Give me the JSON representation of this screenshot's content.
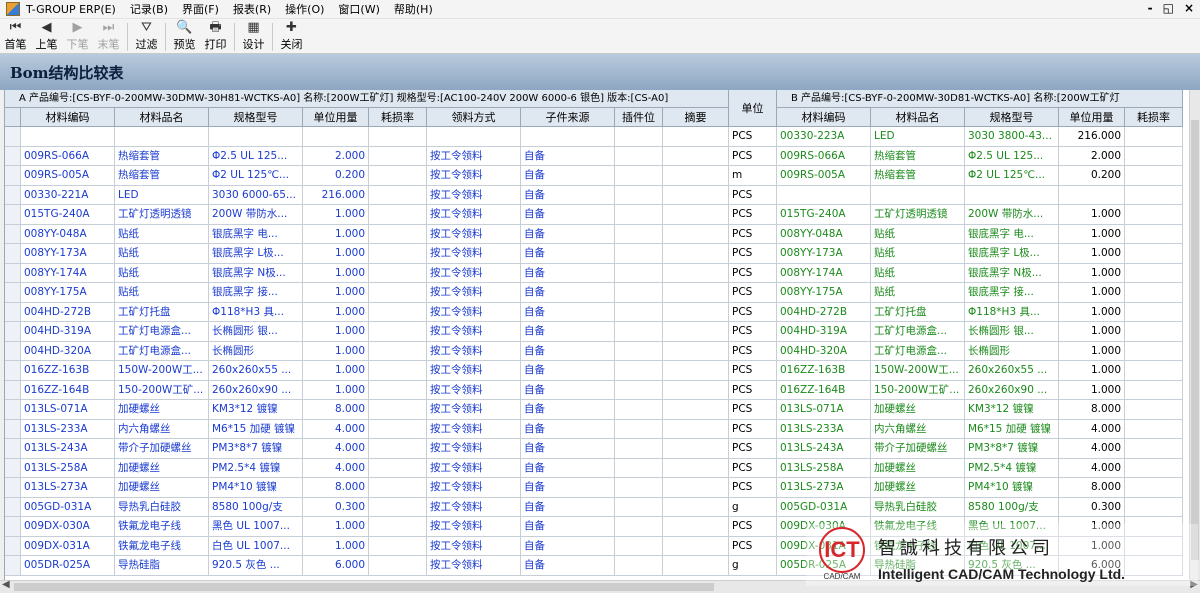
{
  "app": {
    "title": "T-GROUP ERP(E)",
    "menu": [
      "记录(B)",
      "界面(F)",
      "报表(R)",
      "操作(O)",
      "窗口(W)",
      "帮助(H)"
    ],
    "window_controls": [
      "-",
      "◱",
      "×"
    ]
  },
  "toolbar": [
    {
      "label": "首笔",
      "icon": "first-record-icon",
      "glyph": "⏮",
      "enabled": true
    },
    {
      "label": "上笔",
      "icon": "prev-record-icon",
      "glyph": "◀",
      "enabled": true
    },
    {
      "label": "下笔",
      "icon": "next-record-icon",
      "glyph": "▶",
      "enabled": false
    },
    {
      "label": "末笔",
      "icon": "last-record-icon",
      "glyph": "⏭",
      "enabled": false
    },
    {
      "label": "过滤",
      "icon": "filter-icon",
      "glyph": "⛛",
      "enabled": true
    },
    {
      "label": "预览",
      "icon": "preview-icon",
      "glyph": "🔍",
      "enabled": true
    },
    {
      "label": "打印",
      "icon": "print-icon",
      "glyph": "🖶",
      "enabled": true
    },
    {
      "label": "设计",
      "icon": "design-icon",
      "glyph": "▦",
      "enabled": true
    },
    {
      "label": "关闭",
      "icon": "close-icon",
      "glyph": "✚",
      "enabled": true
    }
  ],
  "page_title": "Bom结构比较表",
  "grid": {
    "a_header": "A 产品编号:[CS-BYF-0-200MW-30DMW-30H81-WCTKS-A0] 名称:[200W工矿灯] 规格型号:[AC100-240V 200W 6000-6 银色] 版本:[CS-A0]",
    "b_header": "B 产品编号:[CS-BYF-0-200MW-30D81-WCTKS-A0] 名称:[200W工矿灯",
    "unit_header": "单位",
    "a_columns": [
      "材料编码",
      "材料品名",
      "规格型号",
      "单位用量",
      "耗损率",
      "领料方式",
      "子件来源",
      "插件位",
      "摘要"
    ],
    "b_columns": [
      "材料编码",
      "材料品名",
      "规格型号",
      "单位用量",
      "耗损率"
    ],
    "rows": [
      {
        "a": [
          "",
          "",
          "",
          "",
          "",
          "",
          "",
          "",
          ""
        ],
        "unit": "PCS",
        "b": [
          "00330-223A",
          "LED",
          "3030 3800-43...",
          "216.000",
          ""
        ]
      },
      {
        "a": [
          "009RS-066A",
          "热缩套管",
          "Φ2.5 UL 125...",
          "2.000",
          "",
          "按工令领料",
          "自备",
          "",
          ""
        ],
        "unit": "PCS",
        "b": [
          "009RS-066A",
          "热缩套管",
          "Φ2.5 UL 125...",
          "2.000",
          ""
        ]
      },
      {
        "a": [
          "009RS-005A",
          "热缩套管",
          "Φ2 UL 125℃...",
          "0.200",
          "",
          "按工令领料",
          "自备",
          "",
          ""
        ],
        "unit": "m",
        "b": [
          "009RS-005A",
          "热缩套管",
          "Φ2 UL 125℃...",
          "0.200",
          ""
        ]
      },
      {
        "a": [
          "00330-221A",
          "LED",
          "3030 6000-65...",
          "216.000",
          "",
          "按工令领料",
          "自备",
          "",
          ""
        ],
        "unit": "PCS",
        "b": [
          "",
          "",
          "",
          "",
          ""
        ]
      },
      {
        "a": [
          "015TG-240A",
          "工矿灯透明透镜",
          "200W 带防水...",
          "1.000",
          "",
          "按工令领料",
          "自备",
          "",
          ""
        ],
        "unit": "PCS",
        "b": [
          "015TG-240A",
          "工矿灯透明透镜",
          "200W 带防水...",
          "1.000",
          ""
        ]
      },
      {
        "a": [
          "008YY-048A",
          "贴纸",
          "银底黑字 电...",
          "1.000",
          "",
          "按工令领料",
          "自备",
          "",
          ""
        ],
        "unit": "PCS",
        "b": [
          "008YY-048A",
          "贴纸",
          "银底黑字 电...",
          "1.000",
          ""
        ]
      },
      {
        "a": [
          "008YY-173A",
          "贴纸",
          "银底黑字 L极...",
          "1.000",
          "",
          "按工令领料",
          "自备",
          "",
          ""
        ],
        "unit": "PCS",
        "b": [
          "008YY-173A",
          "贴纸",
          "银底黑字 L极...",
          "1.000",
          ""
        ]
      },
      {
        "a": [
          "008YY-174A",
          "贴纸",
          "银底黑字 N极...",
          "1.000",
          "",
          "按工令领料",
          "自备",
          "",
          ""
        ],
        "unit": "PCS",
        "b": [
          "008YY-174A",
          "贴纸",
          "银底黑字 N极...",
          "1.000",
          ""
        ]
      },
      {
        "a": [
          "008YY-175A",
          "贴纸",
          "银底黑字 接...",
          "1.000",
          "",
          "按工令领料",
          "自备",
          "",
          ""
        ],
        "unit": "PCS",
        "b": [
          "008YY-175A",
          "贴纸",
          "银底黑字 接...",
          "1.000",
          ""
        ]
      },
      {
        "a": [
          "004HD-272B",
          "工矿灯托盘",
          "Φ118*H3 具...",
          "1.000",
          "",
          "按工令领料",
          "自备",
          "",
          ""
        ],
        "unit": "PCS",
        "b": [
          "004HD-272B",
          "工矿灯托盘",
          "Φ118*H3 具...",
          "1.000",
          ""
        ]
      },
      {
        "a": [
          "004HD-319A",
          "工矿灯电源盒...",
          "长椭圆形 银...",
          "1.000",
          "",
          "按工令领料",
          "自备",
          "",
          ""
        ],
        "unit": "PCS",
        "b": [
          "004HD-319A",
          "工矿灯电源盒...",
          "长椭圆形 银...",
          "1.000",
          ""
        ]
      },
      {
        "a": [
          "004HD-320A",
          "工矿灯电源盒...",
          "长椭圆形",
          "1.000",
          "",
          "按工令领料",
          "自备",
          "",
          ""
        ],
        "unit": "PCS",
        "b": [
          "004HD-320A",
          "工矿灯电源盒...",
          "长椭圆形",
          "1.000",
          ""
        ]
      },
      {
        "a": [
          "016ZZ-163B",
          "150W-200W工...",
          "260x260x55 ...",
          "1.000",
          "",
          "按工令领料",
          "自备",
          "",
          ""
        ],
        "unit": "PCS",
        "b": [
          "016ZZ-163B",
          "150W-200W工...",
          "260x260x55 ...",
          "1.000",
          ""
        ]
      },
      {
        "a": [
          "016ZZ-164B",
          "150-200W工矿...",
          "260x260x90 ...",
          "1.000",
          "",
          "按工令领料",
          "自备",
          "",
          ""
        ],
        "unit": "PCS",
        "b": [
          "016ZZ-164B",
          "150-200W工矿...",
          "260x260x90 ...",
          "1.000",
          ""
        ]
      },
      {
        "a": [
          "013LS-071A",
          "加硬螺丝",
          "KM3*12 镀镍",
          "8.000",
          "",
          "按工令领料",
          "自备",
          "",
          ""
        ],
        "unit": "PCS",
        "b": [
          "013LS-071A",
          "加硬螺丝",
          "KM3*12 镀镍",
          "8.000",
          ""
        ]
      },
      {
        "a": [
          "013LS-233A",
          "内六角螺丝",
          "M6*15 加硬 镀镍",
          "4.000",
          "",
          "按工令领料",
          "自备",
          "",
          ""
        ],
        "unit": "PCS",
        "b": [
          "013LS-233A",
          "内六角螺丝",
          "M6*15 加硬 镀镍",
          "4.000",
          ""
        ]
      },
      {
        "a": [
          "013LS-243A",
          "带介子加硬螺丝",
          "PM3*8*7 镀镍",
          "4.000",
          "",
          "按工令领料",
          "自备",
          "",
          ""
        ],
        "unit": "PCS",
        "b": [
          "013LS-243A",
          "带介子加硬螺丝",
          "PM3*8*7 镀镍",
          "4.000",
          ""
        ]
      },
      {
        "a": [
          "013LS-258A",
          "加硬螺丝",
          "PM2.5*4 镀镍",
          "4.000",
          "",
          "按工令领料",
          "自备",
          "",
          ""
        ],
        "unit": "PCS",
        "b": [
          "013LS-258A",
          "加硬螺丝",
          "PM2.5*4 镀镍",
          "4.000",
          ""
        ]
      },
      {
        "a": [
          "013LS-273A",
          "加硬螺丝",
          "PM4*10 镀镍",
          "8.000",
          "",
          "按工令领料",
          "自备",
          "",
          ""
        ],
        "unit": "PCS",
        "b": [
          "013LS-273A",
          "加硬螺丝",
          "PM4*10 镀镍",
          "8.000",
          ""
        ]
      },
      {
        "a": [
          "005GD-031A",
          "导热乳白硅胶",
          "8580 100g/支",
          "0.300",
          "",
          "按工令领料",
          "自备",
          "",
          ""
        ],
        "unit": "g",
        "b": [
          "005GD-031A",
          "导热乳白硅胶",
          "8580 100g/支",
          "0.300",
          ""
        ]
      },
      {
        "a": [
          "009DX-030A",
          "铁氟龙电子线",
          "黑色 UL 1007...",
          "1.000",
          "",
          "按工令领料",
          "自备",
          "",
          ""
        ],
        "unit": "PCS",
        "b": [
          "009DX-030A",
          "铁氟龙电子线",
          "黑色 UL 1007...",
          "1.000",
          ""
        ]
      },
      {
        "a": [
          "009DX-031A",
          "铁氟龙电子线",
          "白色 UL 1007...",
          "1.000",
          "",
          "按工令领料",
          "自备",
          "",
          ""
        ],
        "unit": "PCS",
        "b": [
          "009DX-031A",
          "铁氟龙电子线",
          "白色 UL 1007...",
          "1.000",
          ""
        ]
      },
      {
        "a": [
          "005DR-025A",
          "导热硅脂",
          "920.5 灰色 ...",
          "6.000",
          "",
          "按工令领料",
          "自备",
          "",
          ""
        ],
        "unit": "g",
        "b": [
          "005DR-025A",
          "导热硅脂",
          "920.5 灰色 ...",
          "6.000",
          ""
        ]
      }
    ]
  },
  "watermark": {
    "logo_text": "ICT",
    "logo_sub": "CAD/CAM",
    "company_cn": "智誠科技有限公司",
    "company_en": "Intelligent CAD/CAM Technology Ltd."
  },
  "colors": {
    "a_code": "#1a3bd0",
    "a_text": "#1a3bd0",
    "b_text": "#1b8a1b",
    "header_bg": "#dfe7f0",
    "title_bg": "#8da6c2",
    "logo_red": "#d9262b"
  }
}
